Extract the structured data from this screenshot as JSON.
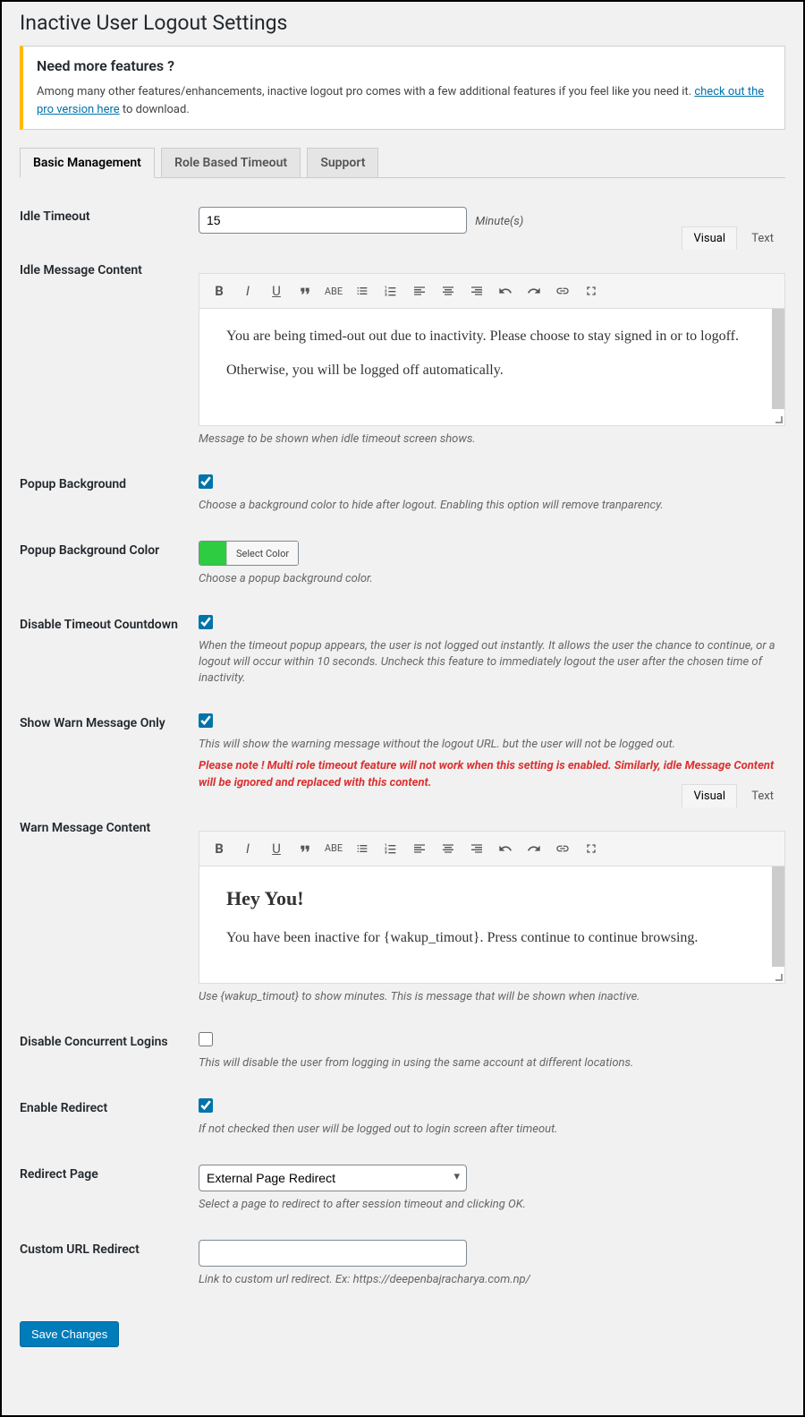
{
  "page_title": "Inactive User Logout Settings",
  "notice": {
    "heading": "Need more features ?",
    "text_before": "Among many other features/enhancements, inactive logout pro comes with a few additional features if you feel like you need it. ",
    "link": "check out the pro version here",
    "text_after": " to download."
  },
  "tabs": {
    "basic": "Basic Management",
    "role": "Role Based Timeout",
    "support": "Support"
  },
  "fields": {
    "idle_timeout": {
      "label": "Idle Timeout",
      "value": "15",
      "unit": "Minute(s)"
    },
    "idle_message": {
      "label": "Idle Message Content",
      "p1": "You are being timed-out out due to inactivity. Please choose to stay signed in or to logoff.",
      "p2": "Otherwise, you will be logged off automatically.",
      "desc": "Message to be shown when idle timeout screen shows."
    },
    "popup_bg": {
      "label": "Popup Background",
      "desc": "Choose a background color to hide after logout. Enabling this option will remove tranparency."
    },
    "popup_bg_color": {
      "label": "Popup Background Color",
      "btn": "Select Color",
      "color": "#2ecc40",
      "desc": "Choose a popup background color."
    },
    "disable_countdown": {
      "label": "Disable Timeout Countdown",
      "desc": "When the timeout popup appears, the user is not logged out instantly. It allows the user the chance to continue, or a logout will occur within 10 seconds. Uncheck this feature to immediately logout the user after the chosen time of inactivity."
    },
    "show_warn": {
      "label": "Show Warn Message Only",
      "desc": "This will show the warning message without the logout URL. but the user will not be logged out.",
      "warning": "Please note ! Multi role timeout feature will not work when this setting is enabled. Similarly, idle Message Content will be ignored and replaced with this content."
    },
    "warn_message": {
      "label": "Warn Message Content",
      "heading": "Hey You!",
      "body": "You have been inactive for {wakup_timout}. Press continue to continue browsing.",
      "desc": "Use {wakup_timout} to show minutes. This is message that will be shown when inactive."
    },
    "disable_concurrent": {
      "label": "Disable Concurrent Logins",
      "desc": "This will disable the user from logging in using the same account at different locations."
    },
    "enable_redirect": {
      "label": "Enable Redirect",
      "desc": "If not checked then user will be logged out to login screen after timeout."
    },
    "redirect_page": {
      "label": "Redirect Page",
      "value": "External Page Redirect",
      "desc": "Select a page to redirect to after session timeout and clicking OK."
    },
    "custom_url": {
      "label": "Custom URL Redirect",
      "value": "",
      "desc": "Link to custom url redirect. Ex: https://deepenbajracharya.com.np/"
    }
  },
  "editor_tabs": {
    "visual": "Visual",
    "text": "Text"
  },
  "save_button": "Save Changes"
}
